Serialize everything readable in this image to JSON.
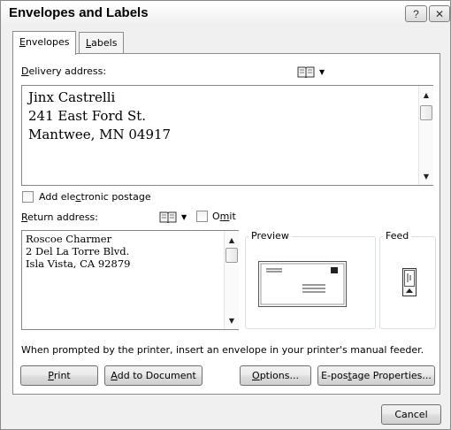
{
  "window": {
    "title": "Envelopes and Labels",
    "help_icon": "question-mark-icon",
    "close_icon": "close-x-icon"
  },
  "tabs": {
    "envelopes": {
      "pre": "",
      "key": "E",
      "post": "nvelopes"
    },
    "labels": {
      "pre": "",
      "key": "L",
      "post": "abels"
    }
  },
  "delivery": {
    "label_pre": "",
    "label_key": "D",
    "label_post": "elivery address:",
    "text": "Jinx Castrelli\n241 East Ford St.\nMantwee, MN 04917",
    "address_book_icon": "address-book-icon"
  },
  "postage": {
    "label_pre": "Add ele",
    "label_key": "c",
    "label_post": "tronic postage",
    "checked": false
  },
  "return": {
    "label_pre": "",
    "label_key": "R",
    "label_post": "eturn address:",
    "text": "Roscoe Charmer\n2 Del La Torre Blvd.\nIsla Vista, CA 92879",
    "omit_pre": "O",
    "omit_key": "m",
    "omit_post": "it",
    "omit_checked": false
  },
  "preview": {
    "label": "Preview",
    "envelope_icon": "envelope-preview-icon"
  },
  "feed": {
    "label": "Feed",
    "feed_icon": "envelope-feed-icon"
  },
  "prompt_text": "When prompted by the printer, insert an envelope in your printer's manual feeder.",
  "buttons": {
    "print": {
      "pre": "",
      "key": "P",
      "post": "rint"
    },
    "add_to_document": {
      "pre": "",
      "key": "A",
      "post": "dd to Document"
    },
    "options": {
      "pre": "",
      "key": "O",
      "post": "ptions..."
    },
    "epostage": {
      "pre": "E-pos",
      "key": "t",
      "post": "age Properties..."
    },
    "cancel": "Cancel"
  }
}
